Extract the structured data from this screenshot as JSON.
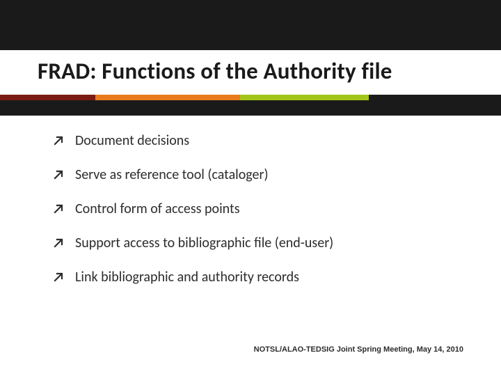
{
  "title": "FRAD: Functions of the Authority file",
  "bullets": [
    "Document decisions",
    "Serve as reference tool (cataloger)",
    "Control form of access points",
    "Support access to bibliographic file (end-user)",
    "Link bibliographic and authority records"
  ],
  "footer": "NOTSL/ALAO-TEDSIG Joint Spring Meeting, May 14, 2010"
}
